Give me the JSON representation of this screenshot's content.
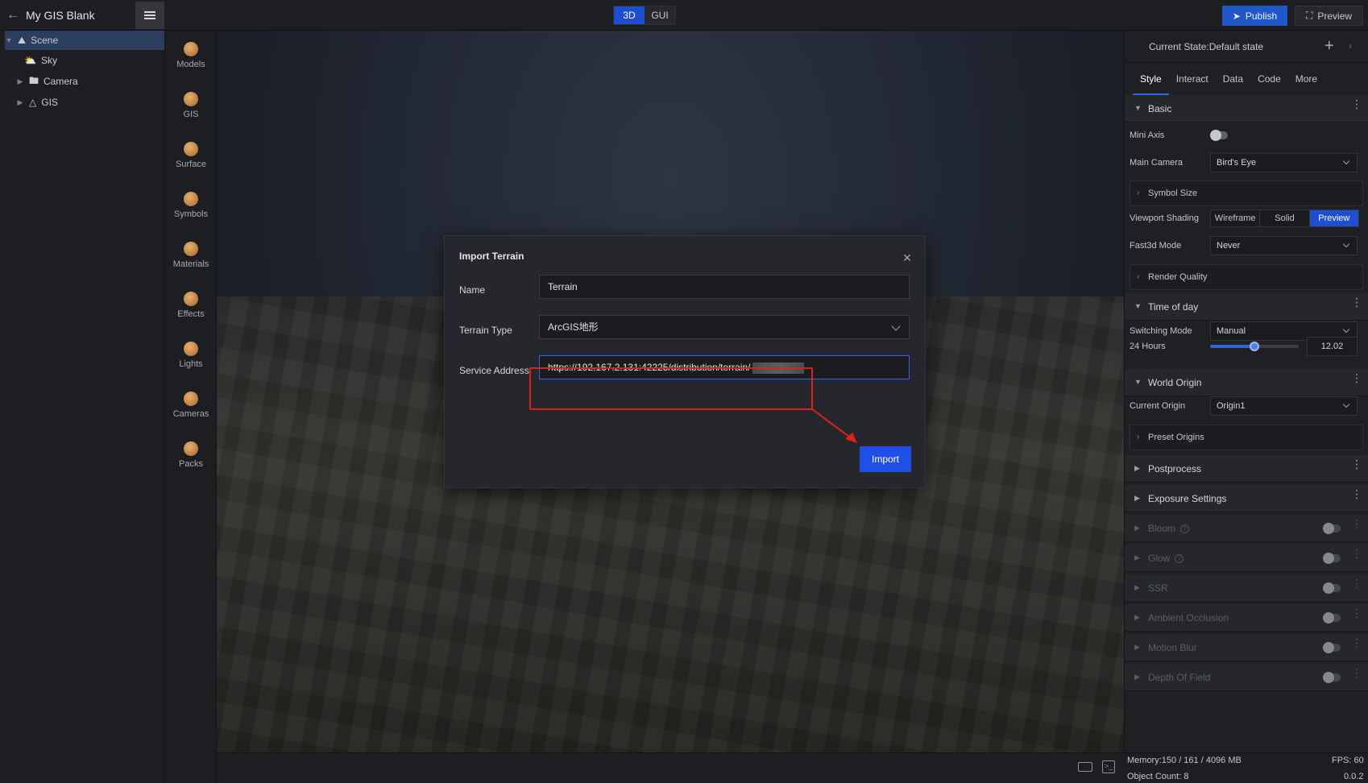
{
  "app": {
    "title": "My GIS Blank",
    "modes": [
      "3D",
      "GUI"
    ],
    "active_mode": "3D",
    "publish_label": "Publish",
    "preview_label": "Preview"
  },
  "scene_tree": [
    {
      "label": "Scene",
      "icon": "scene-icon",
      "selected": true
    },
    {
      "label": "Sky",
      "icon": "sky-icon"
    },
    {
      "label": "Camera",
      "icon": "folder-icon"
    },
    {
      "label": "GIS",
      "icon": "gis-icon"
    }
  ],
  "asset_rail": [
    "Models",
    "GIS",
    "Surface",
    "Symbols",
    "Materials",
    "Effects",
    "Lights",
    "Cameras",
    "Packs"
  ],
  "dialog": {
    "title": "Import Terrain",
    "name_label": "Name",
    "name_value": "Terrain",
    "type_label": "Terrain Type",
    "type_value": "ArcGIS地形",
    "address_label": "Service Address",
    "address_value": "https://192.167.2.131:42225/distribution/terrain/",
    "import_label": "Import"
  },
  "panel": {
    "state_label": "Current State:Default state",
    "tabs": [
      "Style",
      "Interact",
      "Data",
      "Code",
      "More"
    ],
    "active_tab": "Style",
    "basic": "Basic",
    "mini_axis": "Mini Axis",
    "main_camera_label": "Main Camera",
    "main_camera_value": "Bird's Eye",
    "symbol_size": "Symbol Size",
    "viewport_shading": "Viewport Shading",
    "shading_options": [
      "Wireframe",
      "Solid",
      "Preview"
    ],
    "shading_active": "Preview",
    "fast3d_label": "Fast3d Mode",
    "fast3d_value": "Never",
    "render_quality": "Render Quality",
    "time_of_day": "Time of day",
    "switching_label": "Switching Mode",
    "switching_value": "Manual",
    "hours_label": "24 Hours",
    "hours_value": "12.02",
    "hours_fraction": 0.5,
    "world_origin": "World Origin",
    "current_origin_label": "Current Origin",
    "current_origin_value": "Origin1",
    "preset_origins": "Preset Origins",
    "postprocess": "Postprocess",
    "exposure": "Exposure Settings",
    "bloom": "Bloom",
    "glow": "Glow",
    "ssr": "SSR",
    "ao": "Ambient Occlusion",
    "motion_blur": "Motion Blur",
    "dof": "Depth Of Field"
  },
  "status": {
    "memory": "Memory:150 / 161 / 4096 MB",
    "objects": "Object Count: 8",
    "fps": "FPS: 60",
    "version": "0.0.2"
  },
  "colors": {
    "accent": "#1f4fe6",
    "highlight": "#e0211b"
  }
}
